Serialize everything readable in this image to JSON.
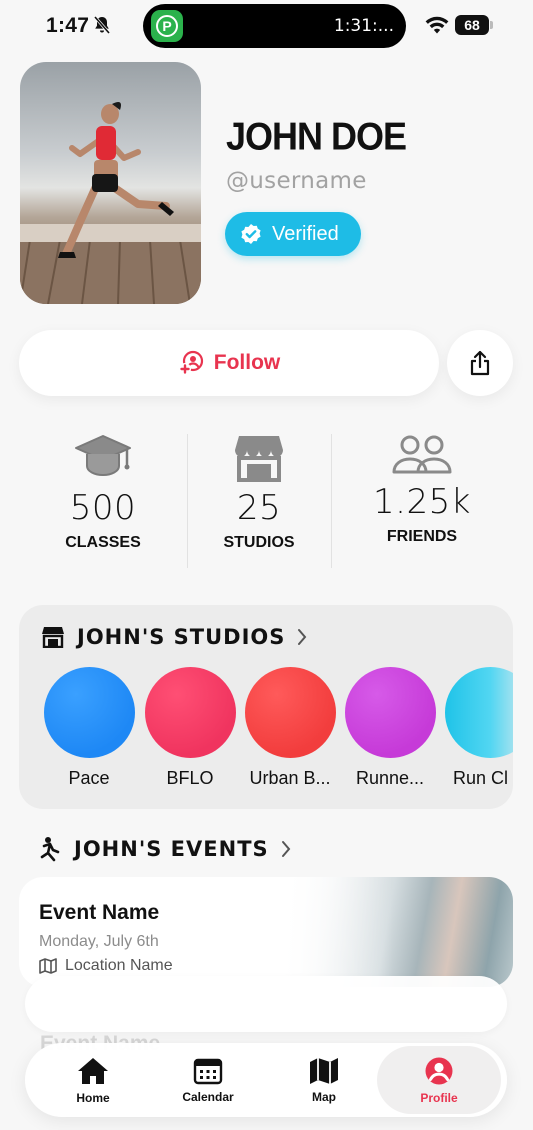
{
  "status_bar": {
    "time": "1:47",
    "live_activity_timer": "1:31:...",
    "live_activity_app": "P",
    "battery": "68"
  },
  "profile": {
    "name": "JOHN DOE",
    "username": "@username",
    "verified_label": "Verified"
  },
  "actions": {
    "follow_label": "Follow"
  },
  "stats": [
    {
      "value": "500",
      "label": "CLASSES",
      "icon": "graduation-cap-icon"
    },
    {
      "value": "25",
      "label": "STUDIOS",
      "icon": "storefront-icon"
    },
    {
      "value": "1.25k",
      "label": "FRIENDS",
      "icon": "people-icon"
    }
  ],
  "studios": {
    "title": "JOHN'S STUDIOS",
    "items": [
      {
        "name": "Pace",
        "color": "#1e88f5"
      },
      {
        "name": "BFLO",
        "color": "#f0345f"
      },
      {
        "name": "Urban B...",
        "color": "#f23d3d"
      },
      {
        "name": "Runne...",
        "color": "#c63ad8"
      },
      {
        "name": "Run Cl",
        "color": "#1fc3e8"
      }
    ]
  },
  "events": {
    "title": "JOHN'S EVENTS",
    "items": [
      {
        "name": "Event Name",
        "date": "Monday, July 6th",
        "location": "Location Name"
      },
      {
        "name": "Event Name"
      }
    ]
  },
  "tab_bar": {
    "tabs": [
      {
        "label": "Home",
        "icon": "home-icon"
      },
      {
        "label": "Calendar",
        "icon": "calendar-icon"
      },
      {
        "label": "Map",
        "icon": "map-icon"
      },
      {
        "label": "Profile",
        "icon": "profile-icon",
        "active": true
      }
    ],
    "accent_color": "#e8344f"
  }
}
